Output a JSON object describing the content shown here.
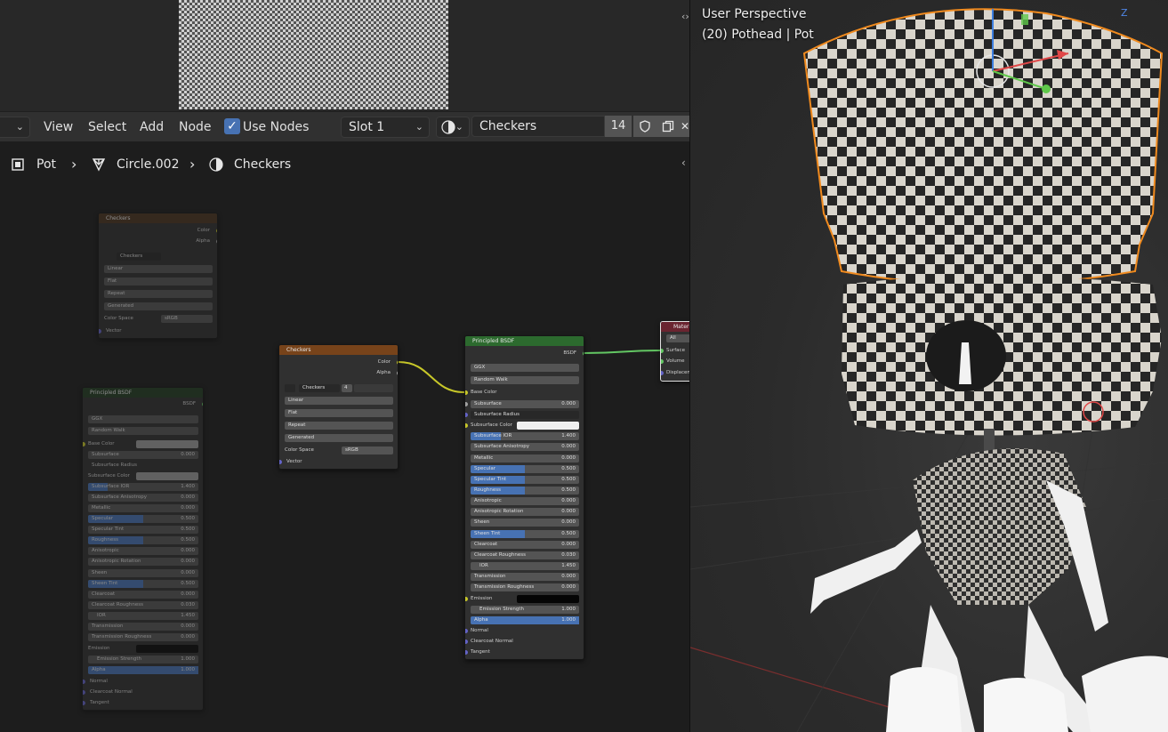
{
  "header": {
    "menu": [
      "View",
      "Select",
      "Add",
      "Node"
    ],
    "use_nodes_label": "Use Nodes",
    "slot": "Slot 1",
    "material_name": "Checkers",
    "user_count": "14"
  },
  "breadcrumb": {
    "object": "Pot",
    "mesh": "Circle.002",
    "material": "Checkers"
  },
  "viewport": {
    "perspective": "User Perspective",
    "object_info": "(20) Pothead | Pot",
    "axis_z": "Z"
  },
  "nodes": {
    "checker_texture_label": "Checkers",
    "out_color": "Color",
    "out_alpha": "Alpha",
    "image_name": "Checkers",
    "image_users": "4",
    "interpolation": "Linear",
    "projection": "Flat",
    "extension": "Repeat",
    "source": "Generated",
    "colorspace_label": "Color Space",
    "colorspace_value": "sRGB",
    "vector": "Vector",
    "bsdf_label": "Principled BSDF",
    "bsdf_out": "BSDF",
    "distribution": "GGX",
    "subsurface_method": "Random Walk",
    "inputs": {
      "base_color": "Base Color",
      "subsurface": "Subsurface",
      "subsurface_radius": "Subsurface Radius",
      "subsurface_color": "Subsurface Color",
      "subsurface_ior": "Subsurface IOR",
      "subsurface_anisotropy": "Subsurface Anisotropy",
      "metallic": "Metallic",
      "specular": "Specular",
      "specular_tint": "Specular Tint",
      "roughness": "Roughness",
      "anisotropic": "Anisotropic",
      "anisotropic_rotation": "Anisotropic Rotation",
      "sheen": "Sheen",
      "sheen_tint": "Sheen Tint",
      "clearcoat": "Clearcoat",
      "clearcoat_roughness": "Clearcoat Roughness",
      "ior": "IOR",
      "transmission": "Transmission",
      "transmission_roughness": "Transmission Roughness",
      "emission": "Emission",
      "emission_strength": "Emission Strength",
      "alpha": "Alpha",
      "normal": "Normal",
      "clearcoat_normal": "Clearcoat Normal",
      "tangent": "Tangent"
    },
    "values": {
      "subsurface": "0.000",
      "subsurface_ior": "1.400",
      "subsurface_anisotropy": "0.000",
      "metallic": "0.000",
      "specular": "0.500",
      "specular_tint": "0.500",
      "roughness": "0.500",
      "anisotropic": "0.000",
      "anisotropic_rotation": "0.000",
      "sheen": "0.000",
      "sheen_tint": "0.500",
      "clearcoat": "0.000",
      "clearcoat_roughness": "0.030",
      "ior": "1.450",
      "transmission": "0.000",
      "transmission_roughness": "0.000",
      "emission_strength": "1.000",
      "alpha": "1.000"
    },
    "output_label": "Material",
    "output_target": "All",
    "output_surface": "Surface",
    "output_volume": "Volume",
    "output_displacement": "Displacement"
  }
}
